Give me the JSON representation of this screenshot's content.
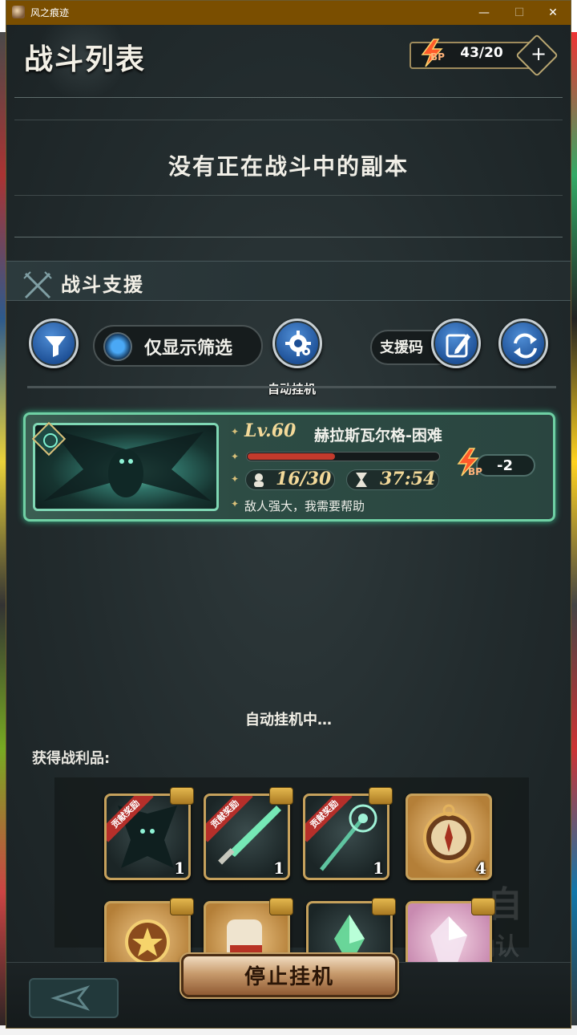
{
  "window": {
    "title": "风之痕迹",
    "min": "—",
    "max": "☐",
    "close": "✕"
  },
  "header": {
    "title": "战斗列表",
    "bp_label": "BP",
    "bp_value": "43/20",
    "bp_plus": "+"
  },
  "status_message": "没有正在战斗中的副本",
  "support": {
    "title": "战斗支援",
    "filter_toggle_label": "仅显示筛选",
    "auto_label": "自动挂机",
    "code_label": "支援码"
  },
  "battle": {
    "level": "Lv.60",
    "boss_name": "赫拉斯瓦尔格-困难",
    "hp_fraction": 0.46,
    "players": "16/30",
    "time_left": "37:54",
    "bp_label": "BP",
    "bp_cost": "-2",
    "message": "敌人强大，我需要帮助"
  },
  "auto_status": "自动挂机中…",
  "loot": {
    "title": "获得战利品:",
    "ribbon_text": "贡献奖励",
    "items": [
      {
        "name": "boss-material",
        "count": "1",
        "ribbon": true
      },
      {
        "name": "jade-sword",
        "count": "1",
        "ribbon": true
      },
      {
        "name": "jade-staff",
        "count": "1",
        "ribbon": true
      },
      {
        "name": "compass",
        "count": "4",
        "ribbon": false
      },
      {
        "name": "star-medal",
        "count": "",
        "ribbon": false
      },
      {
        "name": "gauntlet",
        "count": "",
        "ribbon": false
      },
      {
        "name": "green-crystal",
        "count": "",
        "ribbon": false
      },
      {
        "name": "pink-crystal",
        "count": "",
        "ribbon": false
      }
    ]
  },
  "ghost_confirm": {
    "char_top": "自",
    "char_bottom": "确认"
  },
  "stop_button": "停止挂机",
  "colors": {
    "titlebar": "#7a4e00",
    "card_border": "#6fd0a4",
    "hp_fill": "#c33a2c",
    "accent_gold": "#f3d999",
    "button_blue": "#1d4f95"
  }
}
